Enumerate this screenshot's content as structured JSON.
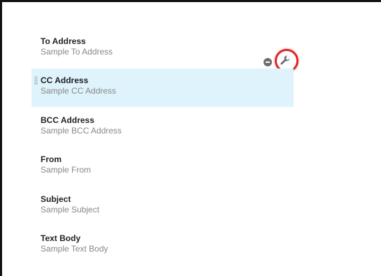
{
  "fields": [
    {
      "label": "To Address",
      "value": "Sample To Address"
    },
    {
      "label": "CC Address",
      "value": "Sample CC Address"
    },
    {
      "label": "BCC Address",
      "value": "Sample BCC Address"
    },
    {
      "label": "From",
      "value": "Sample From"
    },
    {
      "label": "Subject",
      "value": "Sample Subject"
    },
    {
      "label": "Text Body",
      "value": "Sample Text Body"
    }
  ],
  "icons": {
    "remove": "minus-circle-icon",
    "settings": "wrench-icon",
    "drag": "drag-handle-icon"
  },
  "colors": {
    "selected_row_bg": "#dff3fc",
    "highlight_ring": "#e02424",
    "label_text": "#222222",
    "value_text": "#888888"
  }
}
